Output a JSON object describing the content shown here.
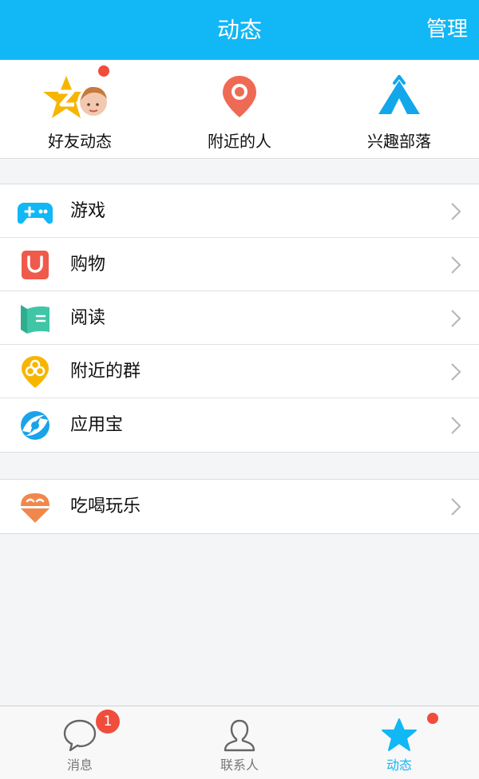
{
  "header": {
    "title": "动态",
    "action_label": "管理"
  },
  "quick_entries": [
    {
      "label": "好友动态",
      "icon": "qzone-star-icon",
      "has_dot": true
    },
    {
      "label": "附近的人",
      "icon": "location-pin-icon"
    },
    {
      "label": "兴趣部落",
      "icon": "tent-icon"
    }
  ],
  "menu_groups": [
    [
      {
        "label": "游戏",
        "icon": "gamepad-icon",
        "color": "#12b7f5"
      },
      {
        "label": "购物",
        "icon": "shopping-bag-icon",
        "color": "#ef5a4b"
      },
      {
        "label": "阅读",
        "icon": "book-icon",
        "color": "#3fc6a6"
      },
      {
        "label": "附近的群",
        "icon": "nearby-group-icon",
        "color": "#f7b500"
      },
      {
        "label": "应用宝",
        "icon": "app-store-icon",
        "color": "#1aa3ea"
      }
    ],
    [
      {
        "label": "吃喝玩乐",
        "icon": "ice-cream-icon",
        "color": "#f2874b"
      }
    ]
  ],
  "tabbar": {
    "tabs": [
      {
        "label": "消息",
        "icon": "chat-bubble-icon",
        "badge": "1"
      },
      {
        "label": "联系人",
        "icon": "contact-person-icon"
      },
      {
        "label": "动态",
        "icon": "star-icon",
        "active": true,
        "has_dot": true
      }
    ]
  },
  "colors": {
    "brand": "#12b7f5",
    "badge": "#f04d3c"
  }
}
